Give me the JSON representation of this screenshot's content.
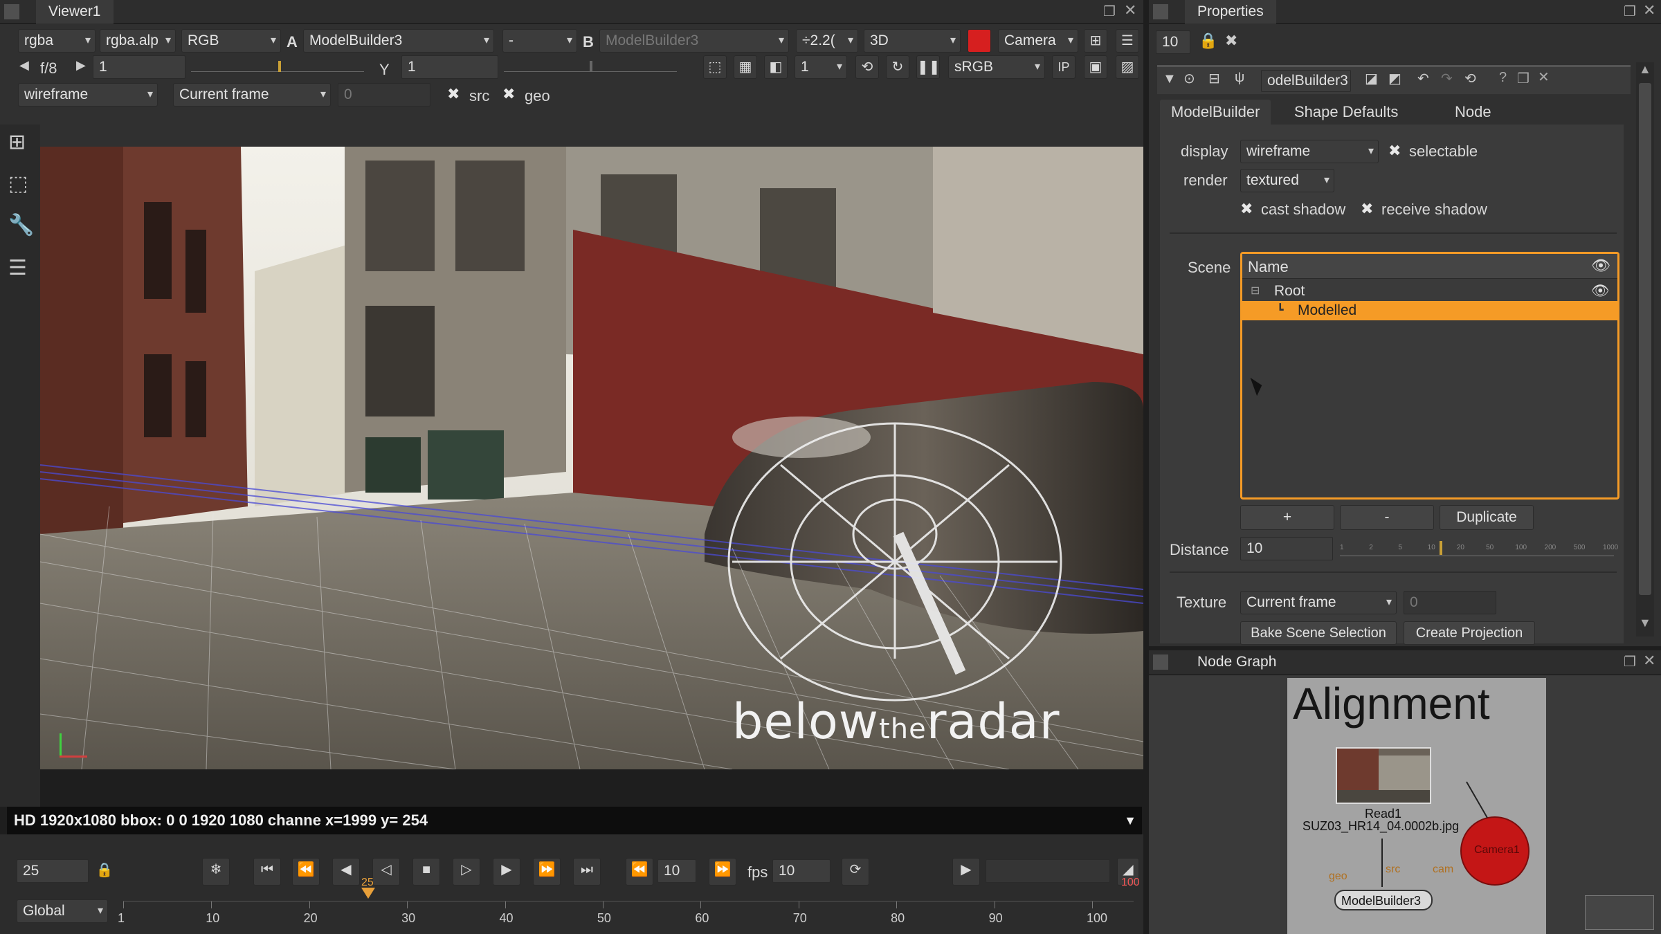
{
  "viewer": {
    "tab": "Viewer1",
    "channels": "rgba",
    "alpha": "rgba.alp",
    "colorspace_ch": "RGB",
    "input_a_label": "A",
    "input_a": "ModelBuilder3",
    "op": "-",
    "input_b_label": "B",
    "input_b": "ModelBuilder3",
    "gain": "÷2.2(",
    "view": "3D",
    "camera": "Camera",
    "fstop": "f/8",
    "gamma_val": "1",
    "y_label": "Y",
    "y_val": "1",
    "proxy": "1",
    "lut": "sRGB",
    "ip": "IP",
    "display": "wireframe",
    "frame_mode": "Current frame",
    "frame_num": "0",
    "src_label": "src",
    "geo_label": "geo",
    "status": "HD 1920x1080 bbox: 0 0 1920 1080 channe x=1999 y= 254",
    "watermark_a": "below",
    "watermark_b": "the",
    "watermark_c": "radar"
  },
  "timeline": {
    "frame": "25",
    "play_frame": "10",
    "fps_label": "fps",
    "fps": "10",
    "range_mode": "Global",
    "ticks": [
      "1",
      "10",
      "20",
      "30",
      "40",
      "50",
      "60",
      "70",
      "80",
      "90",
      "100"
    ],
    "marker_current": "25",
    "marker_end": "100"
  },
  "properties": {
    "title": "Properties",
    "count": "10",
    "node_name": "odelBuilder3",
    "tabs": [
      "ModelBuilder",
      "Shape Defaults",
      "Node"
    ],
    "display_label": "display",
    "display_value": "wireframe",
    "selectable_label": "selectable",
    "render_label": "render",
    "render_value": "textured",
    "cast_shadow_label": "cast shadow",
    "receive_shadow_label": "receive shadow",
    "scene_label": "Scene",
    "scene_header": "Name",
    "tree": [
      "Root",
      "Modelled"
    ],
    "add_label": "+",
    "remove_label": "-",
    "duplicate_label": "Duplicate",
    "distance_label": "Distance",
    "distance_value": "10",
    "slider_ticks": [
      "1",
      "2",
      "5",
      "10",
      "20",
      "50",
      "100",
      "200",
      "500",
      "1000"
    ],
    "distance_level": 0.38,
    "texture_label": "Texture",
    "texture_value": "Current frame",
    "texture_frame": "0",
    "bake_label": "Bake Scene Selection",
    "create_label": "Create Projection"
  },
  "node_graph": {
    "title": "Node Graph",
    "backdrop": "Alignment",
    "read_node": "Read1",
    "read_file": "SUZ03_HR14_04.0002b.jpg",
    "camera_node": "Camera1",
    "mb_node": "ModelBuilder3",
    "pipe_geo": "geo",
    "pipe_src": "src",
    "pipe_cam": "cam"
  },
  "colors": {
    "accent": "#f59b26",
    "record": "#d61f1f",
    "camera_node": "#c41616"
  }
}
